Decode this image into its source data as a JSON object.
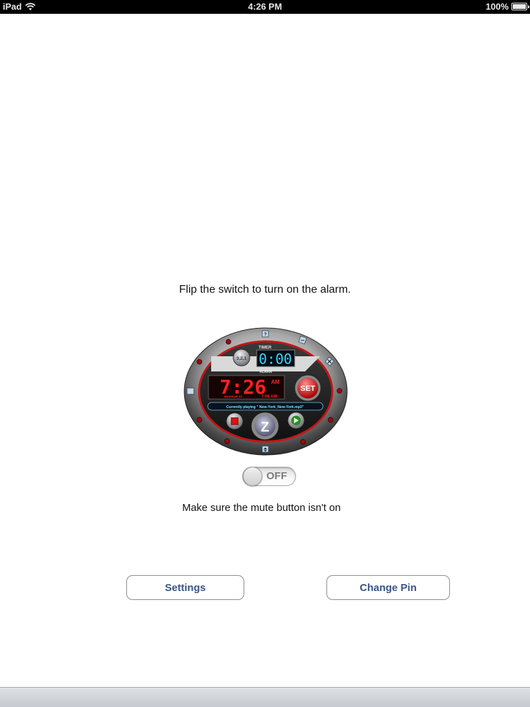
{
  "status_bar": {
    "device": "iPad",
    "time": "4:26 PM",
    "battery": "100%"
  },
  "instructions": {
    "top": "Flip the switch to turn on the alarm.",
    "bottom": "Make sure the mute button isn't on"
  },
  "clock": {
    "timer_label": "TIMER",
    "timer_value": "0:00",
    "countdown_label": "3,2,1",
    "alarm_label": "ALARM",
    "time": "7:26",
    "ampm": "AM",
    "wakeup_label": "WAKEUP AT",
    "wakeup_time": "7:08 AM",
    "set_label": "SET",
    "snooze_label": "Z",
    "help_label": "?",
    "now_playing": "Currently playing \" New-York_New-York.mp3\""
  },
  "toggle": {
    "state": "OFF"
  },
  "buttons": {
    "settings": "Settings",
    "change_pin": "Change Pin"
  },
  "colors": {
    "button_text": "#385487",
    "led_red": "#ff2020",
    "led_cyan": "#3fd3ff"
  }
}
